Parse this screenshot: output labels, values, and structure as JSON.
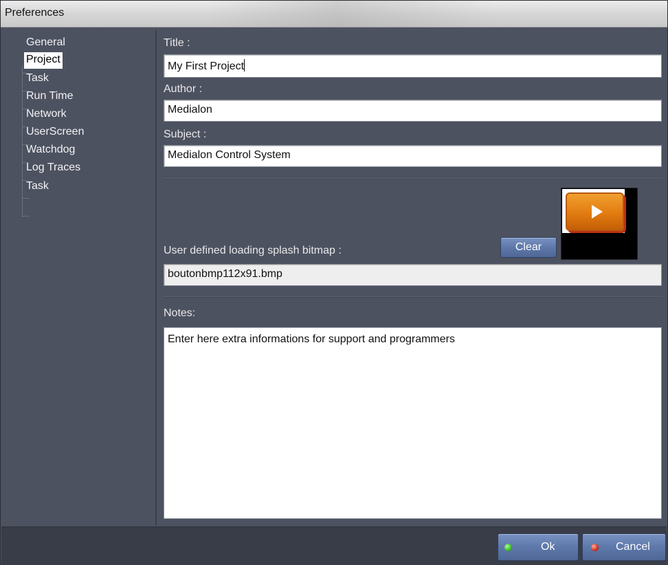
{
  "window": {
    "title": "Preferences"
  },
  "sidebar": {
    "items": [
      {
        "label": "General"
      },
      {
        "label": "Project"
      },
      {
        "label": "Task"
      },
      {
        "label": "Run Time"
      },
      {
        "label": "Network"
      },
      {
        "label": "UserScreen"
      },
      {
        "label": "Watchdog"
      },
      {
        "label": "Log Traces"
      },
      {
        "label": "Task"
      }
    ],
    "selected": "Project"
  },
  "form": {
    "title_label": "Title :",
    "title_value": "My First Project",
    "author_label": "Author :",
    "author_value": "Medialon",
    "subject_label": "Subject :",
    "subject_value": "Medialon Control System",
    "splash_label": "User defined loading splash bitmap :",
    "clear_label": "Clear",
    "splash_value": "boutonbmp112x91.bmp",
    "notes_label": "Notes:",
    "notes_value": "Enter here extra informations for support and programmers"
  },
  "footer": {
    "ok_label": "Ok",
    "cancel_label": "Cancel"
  },
  "colors": {
    "background": "#4d5261",
    "footer": "#393d47",
    "button": "#5e78aa",
    "ok_indicator": "#3fbf2c",
    "cancel_indicator": "#d33a2a"
  },
  "icons": [
    "splash-preview-play-icon",
    "ok-indicator-icon",
    "cancel-indicator-icon"
  ]
}
